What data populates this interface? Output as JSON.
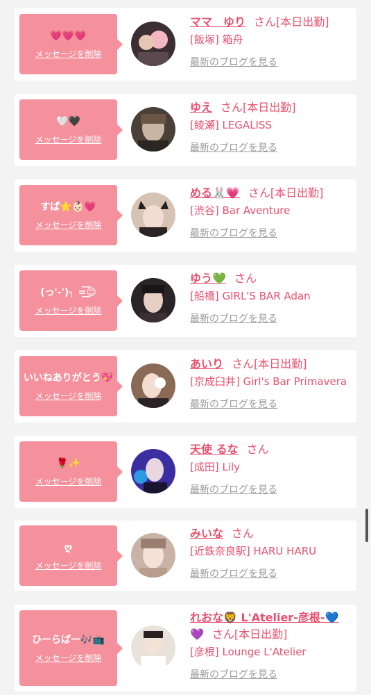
{
  "cards": [
    {
      "message": "💗💗💗",
      "delete_label": "メッセージを削除",
      "name": "ママ　ゆり",
      "suffix": "さん[本日出勤]",
      "suffix_line2": "",
      "shop": "[飯塚] 箱舟",
      "blog_label": "最新のブログを見る",
      "avatar_color": "#3b2f33"
    },
    {
      "message": "🤍🖤",
      "delete_label": "メッセージを削除",
      "name": "ゆえ",
      "suffix": "さん[本日出勤]",
      "suffix_line2": "",
      "shop": "[綾瀬] LEGALISS",
      "blog_label": "最新のブログを見る",
      "avatar_color": "#4a4038"
    },
    {
      "message": "すぱ⭐️👶🏻💗",
      "delete_label": "メッセージを削除",
      "name": "める🐰💗",
      "suffix": "さん[本日出勤]",
      "suffix_line2": "",
      "shop": "[渋谷] Bar Aventure",
      "blog_label": "最新のブログを見る",
      "avatar_color": "#d7c3b4"
    },
    {
      "message": "(っ'-')╮ =͟͟͞͞😊",
      "delete_label": "メッセージを削除",
      "name": "ゆう💚",
      "suffix": "さん",
      "suffix_line2": "",
      "shop": "[船橋] GIRL'S BAR Adan",
      "blog_label": "最新のブログを見る",
      "avatar_color": "#2a2426"
    },
    {
      "message": "いいねありがとう💖",
      "delete_label": "メッセージを削除",
      "name": "あいり",
      "suffix": "さん[本日出勤]",
      "suffix_line2": "",
      "shop": "[京成臼井] Girl's Bar Primavera",
      "blog_label": "最新のブログを見る",
      "avatar_color": "#8a6a55"
    },
    {
      "message": "🌹✨",
      "delete_label": "メッセージを削除",
      "name": "天使 るな",
      "suffix": "さん",
      "suffix_line2": "",
      "shop": "[成田] Lily",
      "blog_label": "最新のブログを見る",
      "avatar_color": "#3a2ea0"
    },
    {
      "message": "ღ",
      "delete_label": "メッセージを削除",
      "name": "みいな",
      "suffix": "さん",
      "suffix_line2": "",
      "shop": "[近鉄奈良駅] HARU HARU",
      "blog_label": "最新のブログを見る",
      "avatar_color": "#c9b2a6"
    },
    {
      "message": "ひーらぱー🎶📺",
      "delete_label": "メッセージを削除",
      "name": "れおな🦁 L'Atelier-彦根-💙",
      "suffix": "さん[本日出勤]",
      "suffix_line2": "💜",
      "shop": "[彦根] Lounge L'Atelier",
      "blog_label": "最新のブログを見る",
      "avatar_color": "#e8e2da"
    }
  ]
}
